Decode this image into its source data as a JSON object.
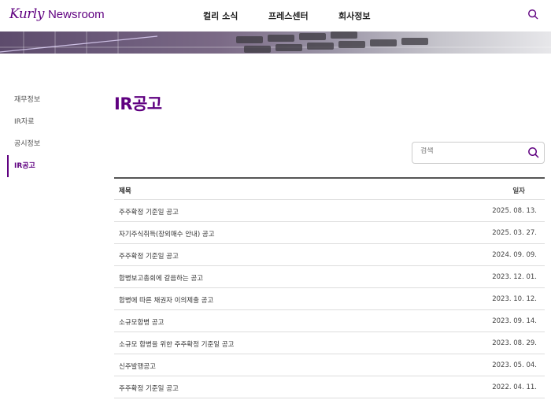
{
  "brand": {
    "script": "Kurly",
    "word": "Newsroom",
    "color": "#5f0080"
  },
  "nav": {
    "items": [
      "컬리 소식",
      "프레스센터",
      "회사정보"
    ]
  },
  "sidebar": {
    "items": [
      {
        "label": "재무정보",
        "active": false
      },
      {
        "label": "IR자료",
        "active": false
      },
      {
        "label": "공시정보",
        "active": false
      },
      {
        "label": "IR공고",
        "active": true
      }
    ]
  },
  "page": {
    "title": "IR공고"
  },
  "search": {
    "placeholder": "검색"
  },
  "table": {
    "headers": {
      "title": "제목",
      "date": "일자"
    },
    "rows": [
      {
        "title": "주주확정 기준일 공고",
        "date": "2025. 08. 13."
      },
      {
        "title": "자기주식취득(장외매수 안내) 공고",
        "date": "2025. 03. 27."
      },
      {
        "title": "주주확정 기준일 공고",
        "date": "2024. 09. 09."
      },
      {
        "title": "합병보고총회에 갈음하는 공고",
        "date": "2023. 12. 01."
      },
      {
        "title": "합병에 따른 채권자 이의제출 공고",
        "date": "2023. 10. 12."
      },
      {
        "title": "소규모합병 공고",
        "date": "2023. 09. 14."
      },
      {
        "title": "소규모 합병을 위한 주주확정 기준일 공고",
        "date": "2023. 08. 29."
      },
      {
        "title": "신주발행공고",
        "date": "2023. 05. 04."
      },
      {
        "title": "주주확정 기준일 공고",
        "date": "2022. 04. 11."
      }
    ]
  }
}
